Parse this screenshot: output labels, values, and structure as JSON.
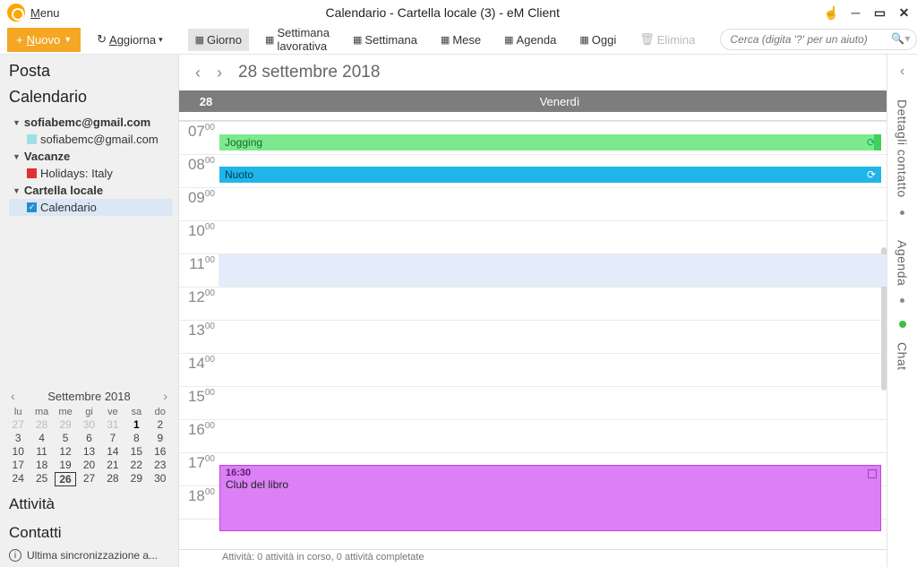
{
  "titlebar": {
    "menu": "Menu",
    "title": "Calendario - Cartella locale (3) - eM Client"
  },
  "toolbar": {
    "nuovo": "Nuovo",
    "aggiorna": "Aggiorna",
    "giorno": "Giorno",
    "settimana_lav": "Settimana lavorativa",
    "settimana": "Settimana",
    "mese": "Mese",
    "agenda": "Agenda",
    "oggi": "Oggi",
    "elimina": "Elimina",
    "search_placeholder": "Cerca (digita '?' per un aiuto)"
  },
  "sidebar": {
    "posta": "Posta",
    "calendario": "Calendario",
    "tree": {
      "acct1": "sofiabemc@gmail.com",
      "acct1_sub": "sofiabemc@gmail.com",
      "vacanze": "Vacanze",
      "holidays": "Holidays: Italy",
      "cartella": "Cartella locale",
      "cal": "Calendario"
    },
    "attivita": "Attività",
    "contatti": "Contatti",
    "sync": "Ultima sincronizzazione a..."
  },
  "minical": {
    "month": "Settembre 2018",
    "dow": [
      "lu",
      "ma",
      "me",
      "gi",
      "ve",
      "sa",
      "do"
    ],
    "rows": [
      [
        {
          "d": "27",
          "dim": true
        },
        {
          "d": "28",
          "dim": true
        },
        {
          "d": "29",
          "dim": true
        },
        {
          "d": "30",
          "dim": true
        },
        {
          "d": "31",
          "dim": true
        },
        {
          "d": "1",
          "bold": true
        },
        {
          "d": "2"
        }
      ],
      [
        {
          "d": "3"
        },
        {
          "d": "4"
        },
        {
          "d": "5"
        },
        {
          "d": "6"
        },
        {
          "d": "7"
        },
        {
          "d": "8"
        },
        {
          "d": "9"
        }
      ],
      [
        {
          "d": "10"
        },
        {
          "d": "11"
        },
        {
          "d": "12"
        },
        {
          "d": "13"
        },
        {
          "d": "14"
        },
        {
          "d": "15"
        },
        {
          "d": "16"
        }
      ],
      [
        {
          "d": "17"
        },
        {
          "d": "18"
        },
        {
          "d": "19"
        },
        {
          "d": "20"
        },
        {
          "d": "21"
        },
        {
          "d": "22"
        },
        {
          "d": "23"
        }
      ],
      [
        {
          "d": "24"
        },
        {
          "d": "25"
        },
        {
          "d": "26",
          "today": true
        },
        {
          "d": "27"
        },
        {
          "d": "28"
        },
        {
          "d": "29"
        },
        {
          "d": "30"
        }
      ]
    ]
  },
  "center": {
    "date": "28 settembre 2018",
    "day_num": "28",
    "day_name": "Venerdì",
    "hours": [
      "07",
      "08",
      "09",
      "10",
      "11",
      "12",
      "13",
      "14",
      "15",
      "16",
      "17",
      "18"
    ],
    "events": {
      "jogging": "Jogging",
      "nuoto": "Nuoto",
      "club_time": "16:30",
      "club_title": "Club del libro"
    },
    "footer": "Attività: 0 attività in corso, 0 attività completate"
  },
  "rightbar": {
    "dettagli": "Dettagli contatto",
    "agenda": "Agenda",
    "chat": "Chat"
  }
}
